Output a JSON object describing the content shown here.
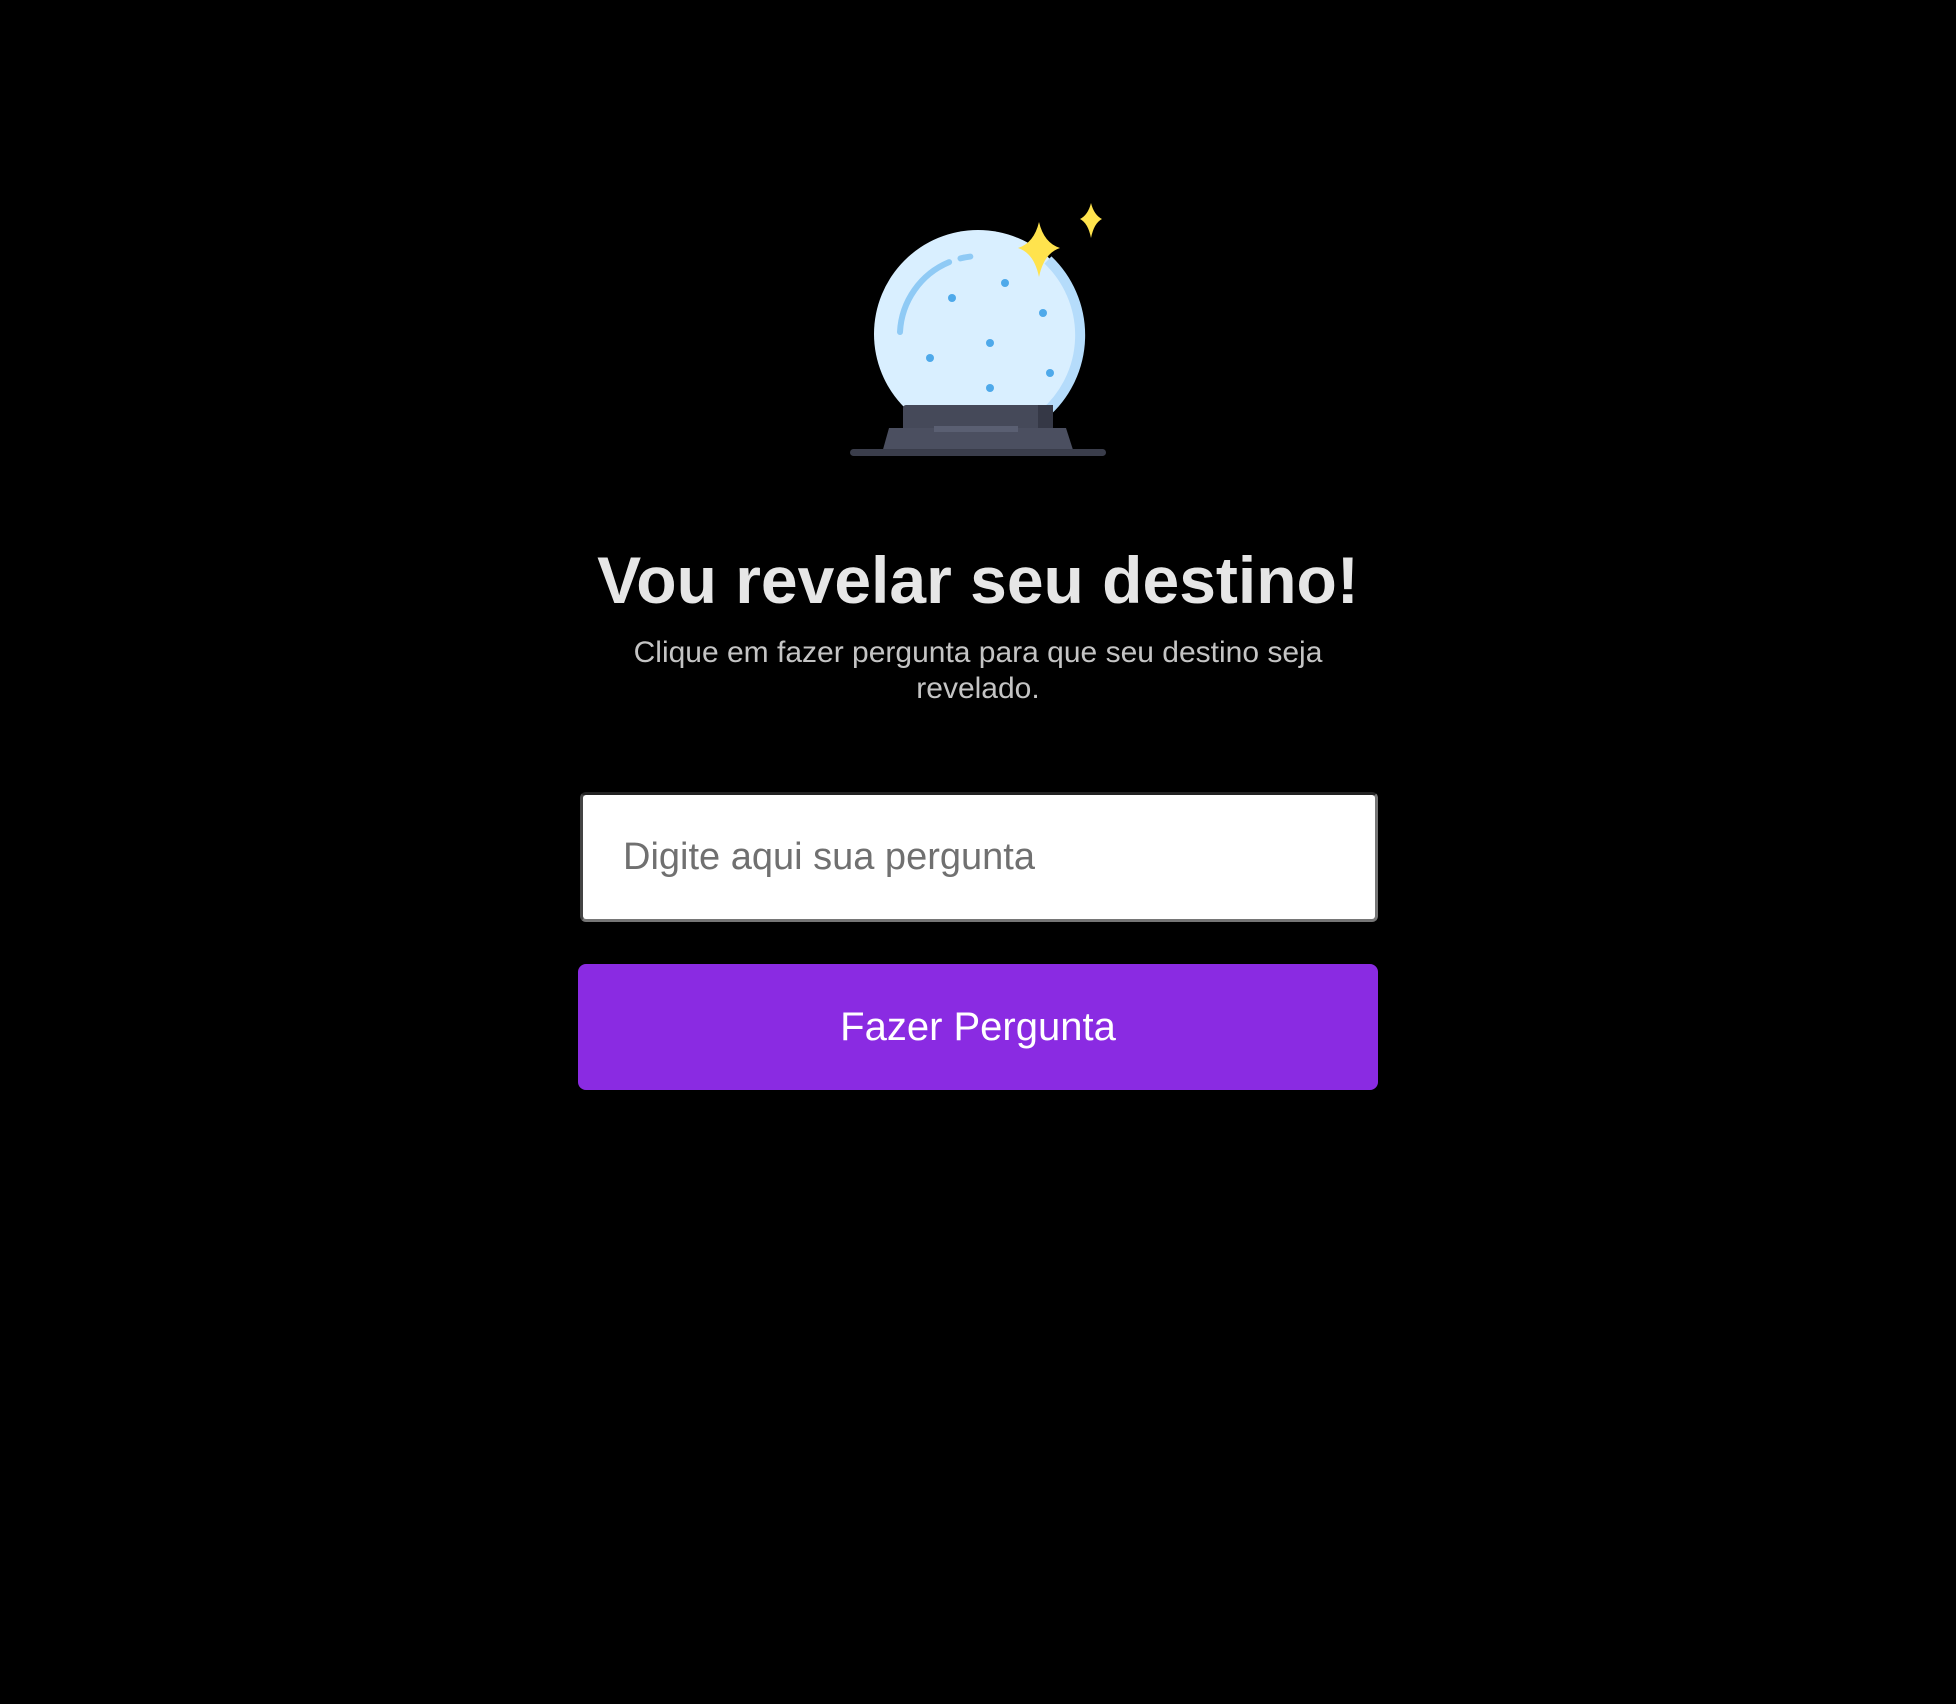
{
  "hero": {
    "icon": "crystal-ball-icon",
    "globe_color": "#d9efff",
    "sparkle_color": "#ffe34d",
    "base_color": "#454959"
  },
  "header": {
    "title": "Vou revelar seu destino!",
    "subtitle": "Clique em fazer pergunta para que seu destino seja revelado."
  },
  "form": {
    "question_placeholder": "Digite aqui sua pergunta",
    "question_value": "",
    "ask_label": "Fazer Pergunta"
  },
  "colors": {
    "background": "#000000",
    "accent": "#8a2be2"
  }
}
